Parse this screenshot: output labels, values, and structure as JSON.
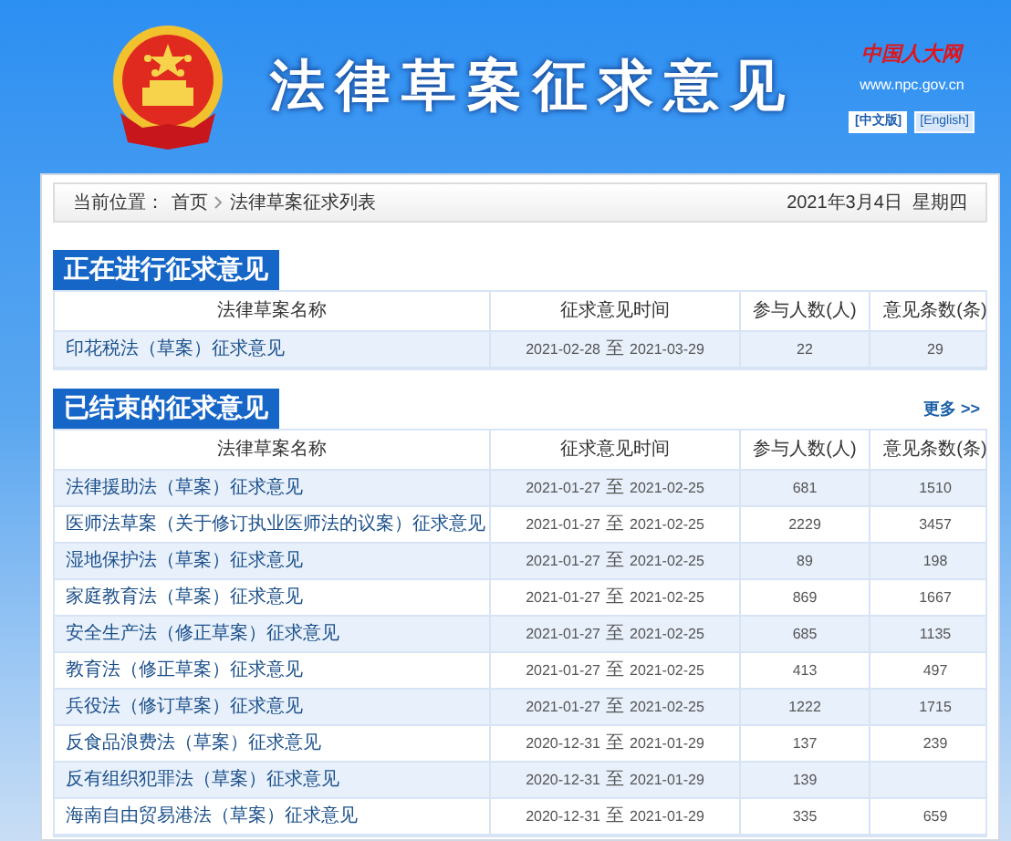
{
  "header": {
    "title": "法律草案征求意见",
    "site_logo": "中国人大网",
    "site_url": "www.npc.gov.cn",
    "languages": [
      {
        "label": "[中文版]",
        "selected": true
      },
      {
        "label": "[English]",
        "selected": false
      }
    ]
  },
  "breadcrumb": {
    "label": "当前位置：",
    "items": [
      "首页",
      "法律草案征求列表"
    ],
    "date": "2021年3月4日  星期四"
  },
  "sections": [
    {
      "title": "正在进行征求意见",
      "columns": [
        "法律草案名称",
        "征求意见时间",
        "参与人数(人)",
        "意见条数(条)"
      ],
      "rows": [
        {
          "name": "印花税法（草案）征求意见",
          "start": "2021-02-28",
          "to": "至",
          "end": "2021-03-29",
          "participants": "22",
          "opinions": "29"
        }
      ]
    },
    {
      "title": "已结束的征求意见",
      "more": "更多 >>",
      "columns": [
        "法律草案名称",
        "征求意见时间",
        "参与人数(人)",
        "意见条数(条)"
      ],
      "rows": [
        {
          "name": "法律援助法（草案）征求意见",
          "start": "2021-01-27",
          "to": "至",
          "end": "2021-02-25",
          "participants": "681",
          "opinions": "1510"
        },
        {
          "name": "医师法草案（关于修订执业医师法的议案）征求意见",
          "start": "2021-01-27",
          "to": "至",
          "end": "2021-02-25",
          "participants": "2229",
          "opinions": "3457"
        },
        {
          "name": "湿地保护法（草案）征求意见",
          "start": "2021-01-27",
          "to": "至",
          "end": "2021-02-25",
          "participants": "89",
          "opinions": "198"
        },
        {
          "name": "家庭教育法（草案）征求意见",
          "start": "2021-01-27",
          "to": "至",
          "end": "2021-02-25",
          "participants": "869",
          "opinions": "1667"
        },
        {
          "name": "安全生产法（修正草案）征求意见",
          "start": "2021-01-27",
          "to": "至",
          "end": "2021-02-25",
          "participants": "685",
          "opinions": "1135"
        },
        {
          "name": "教育法（修正草案）征求意见",
          "start": "2021-01-27",
          "to": "至",
          "end": "2021-02-25",
          "participants": "413",
          "opinions": "497"
        },
        {
          "name": "兵役法（修订草案）征求意见",
          "start": "2021-01-27",
          "to": "至",
          "end": "2021-02-25",
          "participants": "1222",
          "opinions": "1715"
        },
        {
          "name": "反食品浪费法（草案）征求意见",
          "start": "2020-12-31",
          "to": "至",
          "end": "2021-01-29",
          "participants": "137",
          "opinions": "239"
        },
        {
          "name": "反有组织犯罪法（草案）征求意见",
          "start": "2020-12-31",
          "to": "至",
          "end": "2021-01-29",
          "participants": "139"
        },
        {
          "name": "海南自由贸易港法（草案）征求意见",
          "start": "2020-12-31",
          "to": "至",
          "end": "2021-01-29",
          "participants": "335",
          "opinions": "659"
        }
      ]
    }
  ]
}
